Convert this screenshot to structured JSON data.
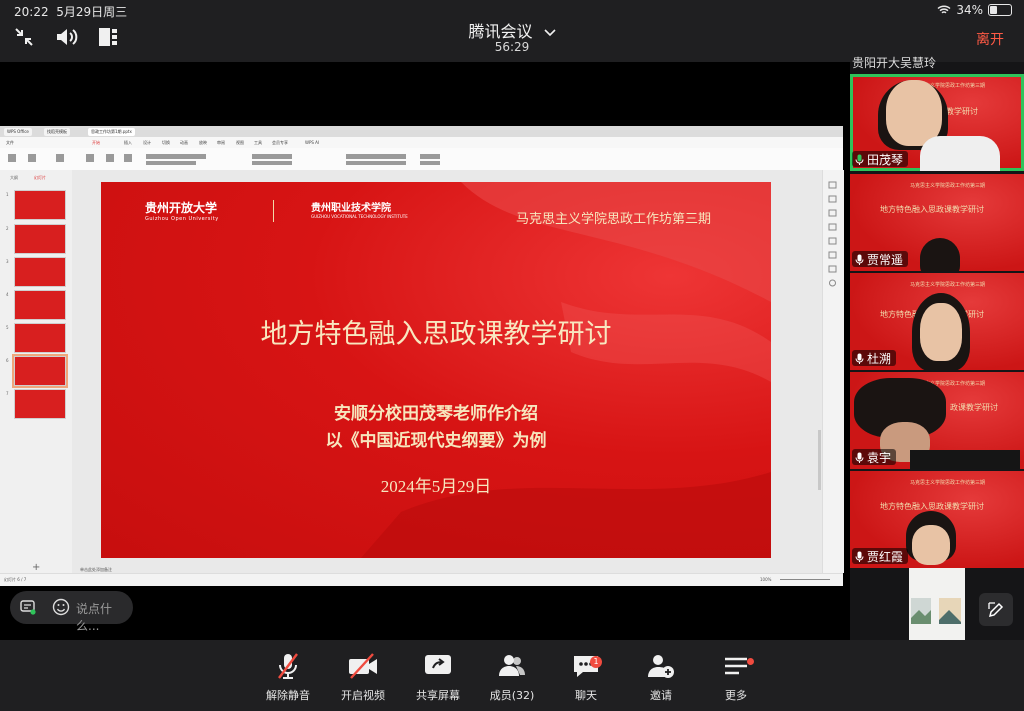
{
  "status": {
    "time": "20:22",
    "date": "5月29日周三",
    "battery": "34%"
  },
  "meeting": {
    "title": "腾讯会议",
    "duration": "56:29",
    "leave_label": "离开"
  },
  "wps": {
    "tabs": [
      "WPS Office",
      "找稻壳模板",
      "思政工作坊第1期.pptx"
    ],
    "menu": [
      "文件",
      "开始",
      "插入",
      "设计",
      "切换",
      "动画",
      "放映",
      "审阅",
      "视图",
      "工具",
      "会员专享",
      "WPS AI"
    ],
    "thumb_numbers": [
      "1",
      "2",
      "3",
      "4",
      "5",
      "6",
      "7"
    ],
    "panel_tabs": [
      "大纲",
      "幻灯片"
    ],
    "status_left": "幻灯片 6 / 7",
    "status_notes": "单击此处添加备注",
    "zoom": "100%"
  },
  "slide": {
    "top_right": "马克思主义学院思政工作坊第三期",
    "logo_left": "贵州开放大学",
    "logo_left_en": "Guizhou Open University",
    "logo_right": "贵州职业技术学院",
    "logo_right_en": "GUIZHOU VOCATIONAL TECHNOLOGY INSTITUTE",
    "title": "地方特色融入思政课教学研讨",
    "subtitle1": "安顺分校田茂琴老师作介绍",
    "subtitle2": "以《中国近现代史纲要》为例",
    "date": "2024年5月29日"
  },
  "chat": {
    "placeholder": "说点什么..."
  },
  "participants": {
    "top_partial": "贵阳开大吴慧玲",
    "items": [
      {
        "name": "田茂琴",
        "active": true
      },
      {
        "name": "贾常遥"
      },
      {
        "name": "杜溯"
      },
      {
        "name": "袁宇"
      },
      {
        "name": "贾红霞"
      }
    ]
  },
  "bottombar": {
    "mute": "解除静音",
    "video": "开启视频",
    "share": "共享屏幕",
    "members": "成员(32)",
    "chat": "聊天",
    "chat_badge": "1",
    "invite": "邀请",
    "more": "更多"
  },
  "colors": {
    "active_speaker": "#2fc35a",
    "leave": "#ff5a45",
    "slide_red": "#d71414",
    "badge": "#f04b3f"
  }
}
